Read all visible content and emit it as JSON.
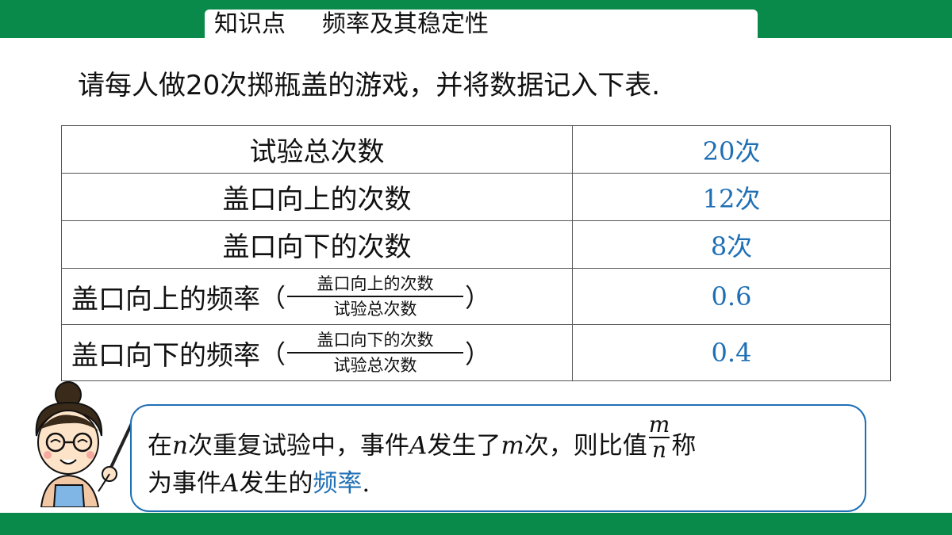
{
  "header": {
    "section_label": "知识点",
    "topic": "频率及其稳定性"
  },
  "instruction": "请每人做20次掷瓶盖的游戏，并将数据记入下表.",
  "table": {
    "rows": [
      {
        "label": "试验总次数",
        "value": "20次"
      },
      {
        "label": "盖口向上的次数",
        "value": "12次"
      },
      {
        "label": "盖口向下的次数",
        "value": "8次"
      },
      {
        "label": "盖口向上的频率",
        "fraction_num": "盖口向上的次数",
        "fraction_den": "试验总次数",
        "value": "0.6"
      },
      {
        "label": "盖口向下的频率",
        "fraction_num": "盖口向下的次数",
        "fraction_den": "试验总次数",
        "value": "0.4"
      }
    ]
  },
  "note": {
    "p1": "在",
    "n": "n",
    "p2": "次重复试验中，事件",
    "A": "A",
    "p3": "发生了",
    "m": "m",
    "p4": "次，则比值",
    "frac_num": "m",
    "frac_den": "n",
    "p5": "称",
    "line2_p1": "为事件",
    "line2_A": "A",
    "line2_p2": "发生的",
    "highlight": "频率",
    "end": "."
  },
  "colors": {
    "band": "#0a8a4a",
    "accent_blue": "#1f6fb5"
  },
  "icons": {
    "teacher": "teacher-illustration"
  }
}
